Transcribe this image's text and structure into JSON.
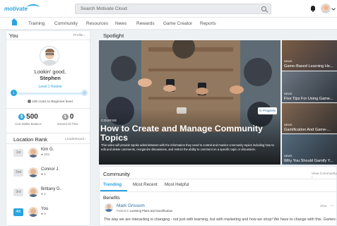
{
  "header": {
    "logo_text": "motivate",
    "search_placeholder": "Search Motivate Cloud"
  },
  "nav": {
    "items": [
      "Training",
      "Community",
      "Resources",
      "News",
      "Rewards",
      "Game Creator",
      "Reports"
    ]
  },
  "you": {
    "title": "You",
    "link": "Profile",
    "greeting": "Lookin' good,",
    "name": "Stephen",
    "level": "Level 1 Rookie",
    "level_start": "1",
    "level_end": "2",
    "level_progress": 0.0,
    "coins_note": "100 coins to Beginner level",
    "coin_balance": "500",
    "coin_balance_label": "Coin Wallet Balance",
    "earned": "0",
    "earned_label": "Earned All Time"
  },
  "rank": {
    "title": "Location Rank",
    "link": "Leaderboard",
    "rows": [
      {
        "place": "1st",
        "name": "Kim G.",
        "coins": "201",
        "me": false
      },
      {
        "place": "2nd",
        "name": "Connor J.",
        "coins": "1",
        "me": false
      },
      {
        "place": "3rd",
        "name": "Brittany G.",
        "coins": "1",
        "me": false
      },
      {
        "place": "4th",
        "name": "You",
        "coins": "0",
        "me": true
      }
    ]
  },
  "spotlight": {
    "title": "Spotlight",
    "hero": {
      "tag": "COURSE",
      "title": "How to Create and Manage Community Topics",
      "description": "This video will provide Spoke administrators with the information they need to control and monitor community topics including how to edit and delete comments, reorganize discussions, and restrict the ability to comment on a specific topic or discussion.",
      "status": "In Progress"
    },
    "side": [
      {
        "tag": "NEWS",
        "title": "Game-Based Learning He..."
      },
      {
        "tag": "NEWS",
        "title": "Five Tips For Using Game..."
      },
      {
        "tag": "NEWS",
        "title": "Gamification And Game-..."
      },
      {
        "tag": "NEWS",
        "title": "Why You Should Gamify Y..."
      }
    ]
  },
  "community": {
    "title": "Community",
    "link": "View Community",
    "tabs": [
      "Trending",
      "Most Recent",
      "Most Helpful"
    ],
    "section": "Benefits",
    "post": {
      "author": "Mark Grissom",
      "posted_in_prefix": "Posted in",
      "posted_in": "Learning Plans and Gamification",
      "time": "2mo",
      "body": "The way we are interacting is changing - not just with learning, but with marketing and how we shop! We have to change with this. Games engage people with social and competitive elements, and as a result, heighten attention, sustain focus, and drive"
    }
  },
  "colors": {
    "accent": "#2aa3e0",
    "background": "#eef1f4"
  }
}
